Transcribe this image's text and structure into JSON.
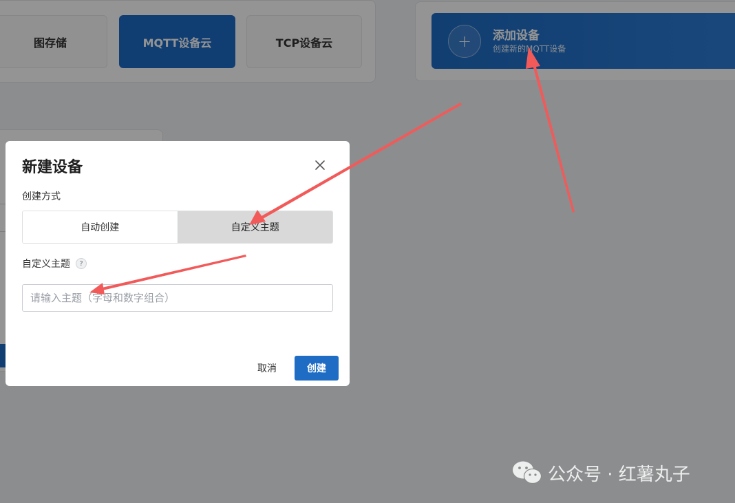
{
  "tabs": [
    {
      "label": "图存储"
    },
    {
      "label": "MQTT设备云"
    },
    {
      "label": "TCP设备云"
    }
  ],
  "add_device": {
    "icon": "plus-icon",
    "title": "添加设备",
    "subtitle": "创建新的MQTT设备"
  },
  "dialog": {
    "title": "新建设备",
    "method_label": "创建方式",
    "methods": [
      {
        "label": "自动创建",
        "selected": false
      },
      {
        "label": "自定义主题",
        "selected": true
      }
    ],
    "topic_label": "自定义主题",
    "help_icon": "?",
    "topic_placeholder": "请输入主题（字母和数字组合）",
    "topic_value": "",
    "cancel_label": "取消",
    "create_label": "创建"
  },
  "watermark": {
    "text": "公众号 · 红薯丸子"
  },
  "colors": {
    "primary": "#1e6cc4",
    "annotation_arrow": "#f25a5a",
    "overlay": "rgba(0,0,0,0.42)"
  }
}
